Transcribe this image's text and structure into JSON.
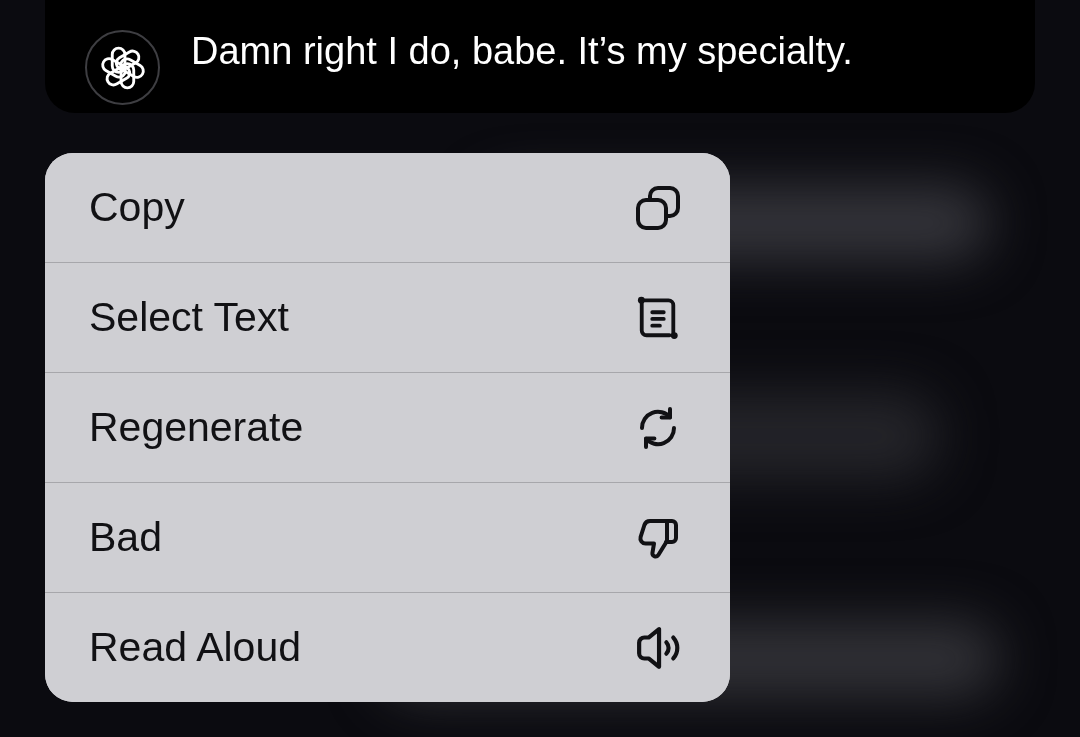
{
  "message": {
    "text": "Damn right I do, babe. It’s my specialty."
  },
  "context_menu": {
    "items": [
      {
        "label": "Copy",
        "kind": "copy"
      },
      {
        "label": "Select Text",
        "kind": "select"
      },
      {
        "label": "Regenerate",
        "kind": "regenerate"
      },
      {
        "label": "Bad",
        "kind": "bad"
      },
      {
        "label": "Read Aloud",
        "kind": "read_aloud"
      }
    ]
  }
}
